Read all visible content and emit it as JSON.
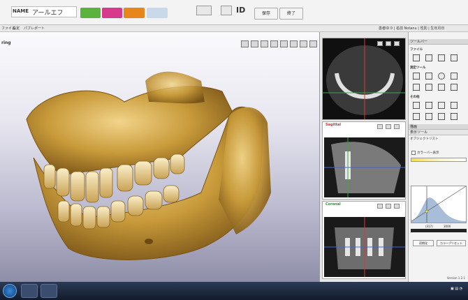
{
  "header": {
    "name_label": "NAME",
    "name_value": "アールエフ",
    "id_label": "ID",
    "save_button": "保存",
    "exit_button": "終了"
  },
  "menu": {
    "items": [
      "ファイル",
      "設定",
      "パブレポート"
    ],
    "right_text": "患者ID 0 | 名前 Notanu | 性別 | 生年月日"
  },
  "viewport": {
    "label": "ring"
  },
  "slices": {
    "sagittal_title": "Sagittal",
    "coronal_title": "Coronal"
  },
  "right_panel": {
    "header": "ツールバー",
    "section_file": "ファイル",
    "section_measure": "測定ツール",
    "section_other": "その他",
    "display_header": "描画",
    "display_sub": "表示ツール",
    "object_list": "オブジェクトリスト",
    "checkbox_label": "カラーバー表示",
    "value_left": "(317)",
    "value_right": "3000",
    "btn_left": "初期化",
    "btn_right": "カラープリセット"
  },
  "statusbar": {
    "version": "Version 1.2.1"
  },
  "colors": {
    "accent_green": "#5bb33e",
    "accent_pink": "#d63a8c",
    "accent_orange": "#e8861e",
    "bone": "#c89a3a"
  }
}
